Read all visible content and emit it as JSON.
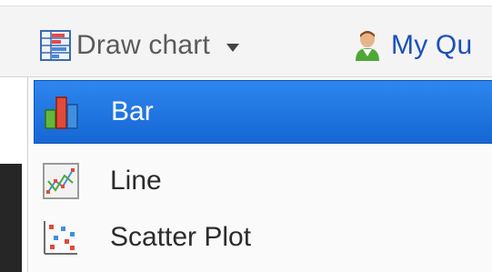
{
  "toolbar": {
    "draw_chart_label": "Draw chart",
    "draw_chart_icon": "chart-grid-icon",
    "my_queries_label": "My Qu",
    "my_queries_icon": "user-icon"
  },
  "menu": {
    "items": [
      {
        "label": "Bar",
        "icon": "bar-chart-icon",
        "selected": true
      },
      {
        "label": "Line",
        "icon": "line-chart-icon",
        "selected": false
      },
      {
        "label": "Scatter Plot",
        "icon": "scatter-plot-icon",
        "selected": false
      }
    ]
  },
  "colors": {
    "selection": "#1e74e0",
    "link": "#1a50b8",
    "toolbar_bg": "#f4f4f4"
  }
}
